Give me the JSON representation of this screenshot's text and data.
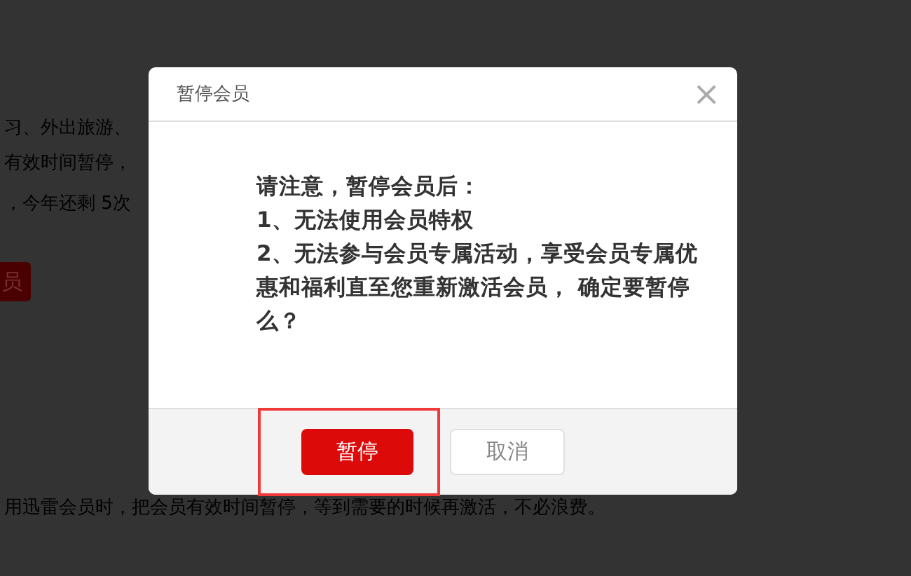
{
  "background_page": {
    "lines": [
      "习、外出旅游、",
      "有效时间暂停，",
      "，今年还剩 5次"
    ],
    "button": "员",
    "footer_text": "用迅雷会员时，把会员有效时间暂停，等到需要的时候再激活，不必浪费。"
  },
  "dialog": {
    "title": "暂停会员",
    "close": "×",
    "message": [
      "请注意，暂停会员后：",
      "1、无法使用会员特权",
      "2、无法参与会员专属活动，享受会员专属优惠和福利直至您重新激活会员， 确定要暂停么？"
    ],
    "buttons": [
      {
        "label": "暂停",
        "kind": "primary",
        "highlighted": true
      },
      {
        "label": "取消",
        "kind": "secondary",
        "highlighted": false
      }
    ]
  }
}
